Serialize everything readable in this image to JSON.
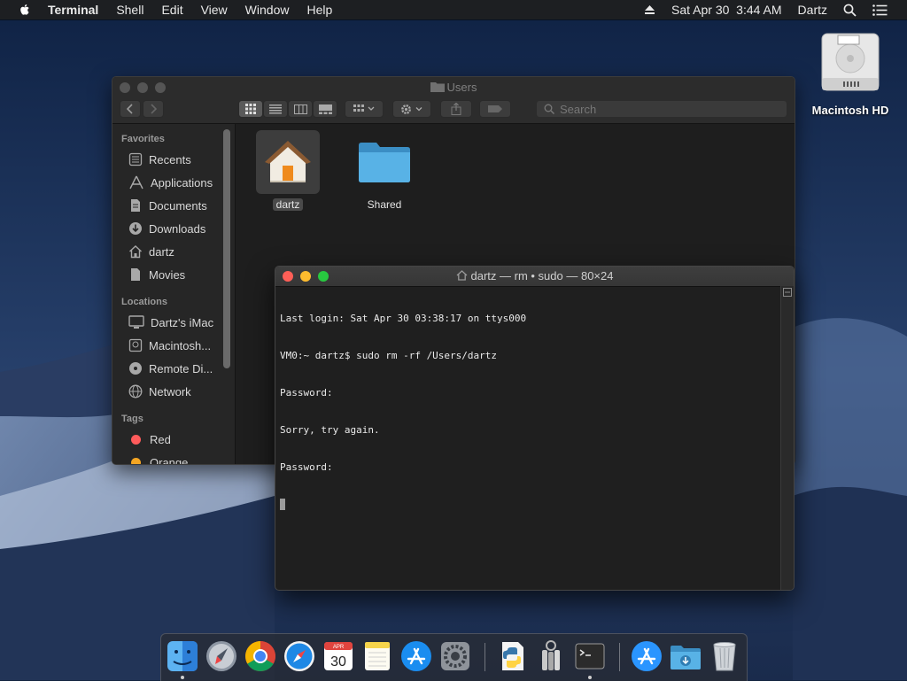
{
  "menubar": {
    "app_name": "Terminal",
    "items": [
      "Shell",
      "Edit",
      "View",
      "Window",
      "Help"
    ],
    "datetime": "Sat Apr 30  3:44 AM",
    "user": "Dartz"
  },
  "desktop": {
    "drive_label": "Macintosh HD"
  },
  "finder": {
    "title": "Users",
    "search_placeholder": "Search",
    "sidebar": {
      "favorites_header": "Favorites",
      "favorites": [
        "Recents",
        "Applications",
        "Documents",
        "Downloads",
        "dartz",
        "Movies"
      ],
      "locations_header": "Locations",
      "locations": [
        "Dartz's iMac",
        "Macintosh...",
        "Remote Di...",
        "Network"
      ],
      "tags_header": "Tags",
      "tags": [
        {
          "label": "Red",
          "color": "#ff5b5b"
        },
        {
          "label": "Orange",
          "color": "#f5a623"
        }
      ]
    },
    "items": [
      {
        "name": "dartz",
        "selected": true
      },
      {
        "name": "Shared",
        "selected": false
      }
    ]
  },
  "terminal": {
    "title": "dartz — rm • sudo — 80×24",
    "lines": [
      "Last login: Sat Apr 30 03:38:17 on ttys000",
      "VM0:~ dartz$ sudo rm -rf /Users/dartz",
      "Password:",
      "Sorry, try again.",
      "Password:"
    ]
  },
  "dock": {
    "apps": [
      "Finder",
      "Launchpad",
      "Google Chrome",
      "Safari",
      "Calendar",
      "Notes",
      "App Store",
      "System Preferences",
      "Python Launcher",
      "Keychain Access",
      "Terminal",
      "App Store",
      "Downloads",
      "Trash"
    ],
    "calendar_month": "APR",
    "calendar_day": "30"
  },
  "colors": {
    "close": "#ff5f57",
    "minimize": "#febc2e",
    "zoom": "#28c840",
    "folder": "#4ba3da"
  }
}
